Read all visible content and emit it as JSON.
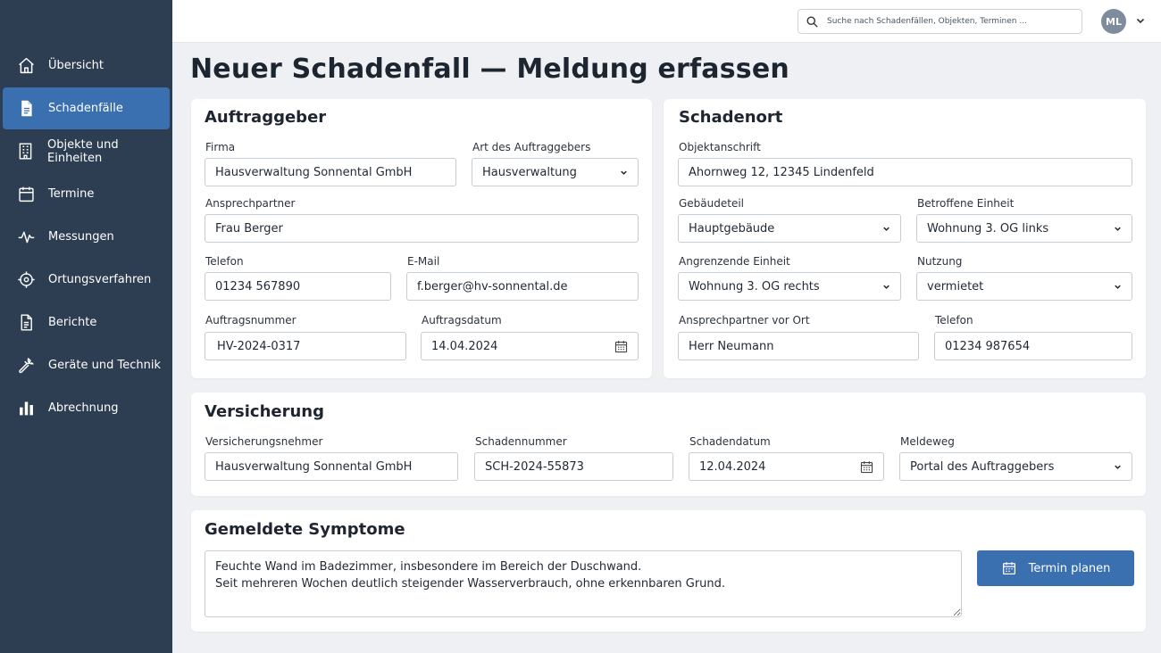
{
  "sidebar": {
    "items": [
      {
        "label": "Übersicht",
        "icon": "home-icon",
        "active": false
      },
      {
        "label": "Schadenfälle",
        "icon": "document-icon",
        "active": true
      },
      {
        "label": "Objekte und Einheiten",
        "icon": "building-icon",
        "active": false
      },
      {
        "label": "Termine",
        "icon": "calendar-icon",
        "active": false
      },
      {
        "label": "Messungen",
        "icon": "pulse-icon",
        "active": false
      },
      {
        "label": "Ortungsverfahren",
        "icon": "target-icon",
        "active": false
      },
      {
        "label": "Berichte",
        "icon": "report-icon",
        "active": false
      },
      {
        "label": "Geräte und Technik",
        "icon": "wrench-icon",
        "active": false
      },
      {
        "label": "Abrechnung",
        "icon": "bar-chart-icon",
        "active": false
      }
    ]
  },
  "topbar": {
    "search_placeholder": "Suche nach Schadenfällen, Objekten, Terminen ...",
    "avatar_initials": "ML"
  },
  "page": {
    "title": "Neuer Schadenfall — Meldung erfassen"
  },
  "auftraggeber": {
    "title": "Auftraggeber",
    "firma_label": "Firma",
    "firma_value": "Hausverwaltung Sonnental GmbH",
    "art_label": "Art des Auftraggebers",
    "art_value": "Hausverwaltung",
    "ansprechpartner_label": "Ansprechpartner",
    "ansprechpartner_value": "Frau Berger",
    "telefon_label": "Telefon",
    "telefon_value": "01234 567890",
    "email_label": "E-Mail",
    "email_value": "f.berger@hv-sonnental.de",
    "auftragsnummer_label": "Auftragsnummer",
    "auftragsnummer_value": "HV-2024-0317",
    "auftragsdatum_label": "Auftragsdatum",
    "auftragsdatum_value": "14.04.2024"
  },
  "schadenort": {
    "title": "Schadenort",
    "anschrift_label": "Objektanschrift",
    "anschrift_value": "Ahornweg 12, 12345 Lindenfeld",
    "gebaeudeteil_label": "Gebäudeteil",
    "gebaeudeteil_value": "Hauptgebäude",
    "einheit_label": "Betroffene Einheit",
    "einheit_value": "Wohnung 3. OG links",
    "angrenzend_label": "Angrenzende Einheit",
    "angrenzend_value": "Wohnung 3. OG rechts",
    "nutzung_label": "Nutzung",
    "nutzung_value": "vermietet",
    "ansprechpartner_label": "Ansprechpartner vor Ort",
    "ansprechpartner_value": "Herr Neumann",
    "telefon_label": "Telefon",
    "telefon_value": "01234 987654"
  },
  "versicherung": {
    "title": "Versicherung",
    "nehmer_label": "Versicherungsnehmer",
    "nehmer_value": "Hausverwaltung Sonnental GmbH",
    "schadennummer_label": "Schadennummer",
    "schadennummer_value": "SCH-2024-55873",
    "schadendatum_label": "Schadendatum",
    "schadendatum_value": "12.04.2024",
    "meldeweg_label": "Meldeweg",
    "meldeweg_value": "Portal des Auftraggebers"
  },
  "symptome": {
    "title": "Gemeldete Symptome",
    "text": "Feuchte Wand im Badezimmer, insbesondere im Bereich der Duschwand.\nSeit mehreren Wochen deutlich steigender Wasserverbrauch, ohne erkennbaren Grund.",
    "button_label": "Termin planen"
  },
  "colors": {
    "sidebar_bg": "#2d3e52",
    "accent": "#3a70b0",
    "page_bg": "#eef0f3"
  }
}
